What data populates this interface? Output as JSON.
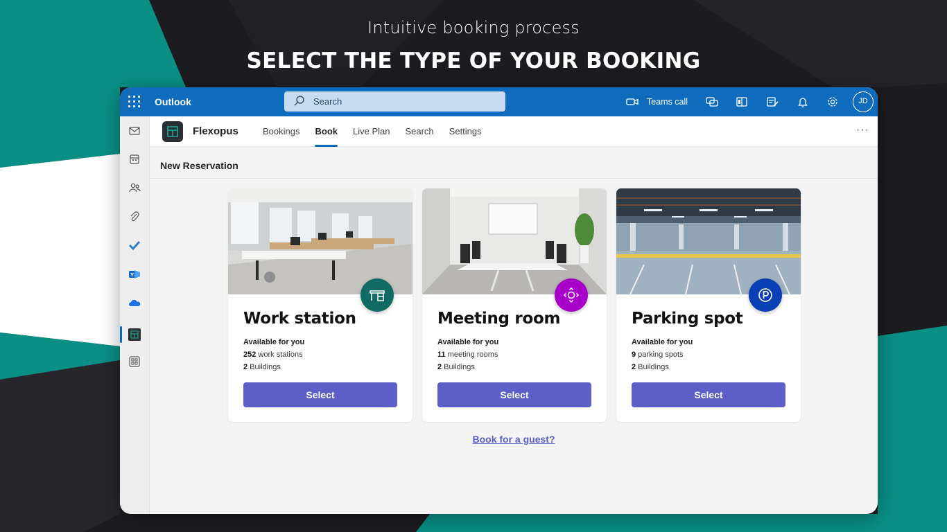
{
  "hero": {
    "subtitle": "Intuitive booking process",
    "title": "SELECT THE TYPE OF YOUR BOOKING"
  },
  "topbar": {
    "app_name": "Outlook",
    "search_placeholder": "Search",
    "teams_call": "Teams call",
    "avatar_initials": "JD",
    "color": "#0f6cbd"
  },
  "rail": {
    "icons": [
      "mail-icon",
      "calendar-icon",
      "people-icon",
      "attach-icon",
      "todo-icon",
      "yammer-icon",
      "onedrive-icon",
      "flexopus-icon",
      "apps-icon"
    ]
  },
  "appbar": {
    "brand": "Flexopus",
    "nav": [
      "Bookings",
      "Book",
      "Live Plan",
      "Search",
      "Settings"
    ],
    "active_nav": "Book",
    "more": "···"
  },
  "page": {
    "section_title": "New Reservation",
    "guest_link": "Book for a guest?"
  },
  "cards": [
    {
      "title": "Work station",
      "available": "Available for you",
      "count": "252",
      "count_label": " work stations",
      "buildings": "2",
      "buildings_label": " Buildings",
      "button": "Select",
      "badge_color": "#0f6b63",
      "icon": "desk-icon"
    },
    {
      "title": "Meeting room",
      "available": "Available for you",
      "count": "11",
      "count_label": " meeting rooms",
      "buildings": "2",
      "buildings_label": " Buildings",
      "button": "Select",
      "badge_color": "#a600c9",
      "icon": "meeting-icon"
    },
    {
      "title": "Parking spot",
      "available": "Available for you",
      "count": "9",
      "count_label": " parking spots",
      "buildings": "2",
      "buildings_label": " Buildings",
      "button": "Select",
      "badge_color": "#0b3fb5",
      "icon": "parking-icon"
    }
  ],
  "colors": {
    "button": "#5b5fc7",
    "teal": "#0a8f84",
    "background": "#1c1c20"
  }
}
